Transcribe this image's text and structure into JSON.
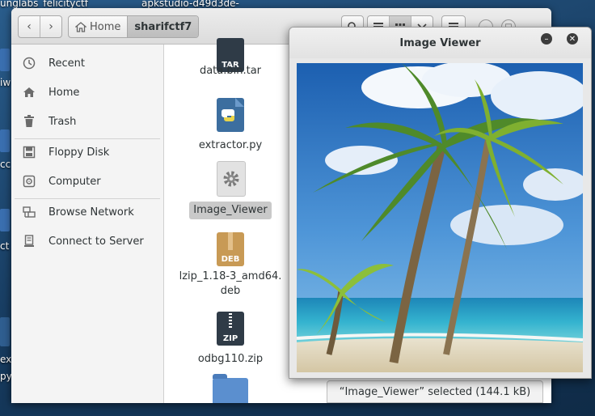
{
  "desktop": {
    "top_left_text": "unglabs_felicityctf",
    "top_right_text": "apkstudio-d49d3de-",
    "side_fragments": [
      "iw",
      "cc",
      "ct",
      "ex",
      "py"
    ]
  },
  "file_manager": {
    "nav": {
      "back_glyph": "‹",
      "forward_glyph": "›"
    },
    "breadcrumb": {
      "home_label": "Home",
      "current_label": "sharifctf7"
    },
    "sidebar": [
      {
        "label": "Recent",
        "icon": "clock-icon"
      },
      {
        "label": "Home",
        "icon": "home-icon"
      },
      {
        "label": "Trash",
        "icon": "trash-icon"
      },
      {
        "label": "Floppy Disk",
        "icon": "floppy-icon"
      },
      {
        "label": "Computer",
        "icon": "computer-icon"
      },
      {
        "label": "Browse Network",
        "icon": "network-icon"
      },
      {
        "label": "Connect to Server",
        "icon": "server-icon"
      }
    ],
    "files": [
      {
        "name": "data.bin.tar",
        "badge": "TAR"
      },
      {
        "name": "extractor.py",
        "badge": ""
      },
      {
        "name": "Image_Viewer",
        "badge": "",
        "selected": true
      },
      {
        "name_line1": "lzip_1.18-3_amd64.",
        "name_line2": "deb",
        "badge": "DEB"
      },
      {
        "name": "odbg110.zip",
        "badge": "ZIP"
      }
    ],
    "status": "“Image_Viewer” selected  (144.1 kB)"
  },
  "image_viewer": {
    "title": "Image Viewer",
    "minimize_glyph": "–",
    "close_glyph": "✕"
  },
  "colors": {
    "desktop": "#1f4e79",
    "selection": "#c9c9c9",
    "python_blue": "#3c6e9f",
    "package_tan": "#c89a55",
    "archive_dark": "#2f3b47",
    "folder_blue": "#5b8fcf"
  }
}
